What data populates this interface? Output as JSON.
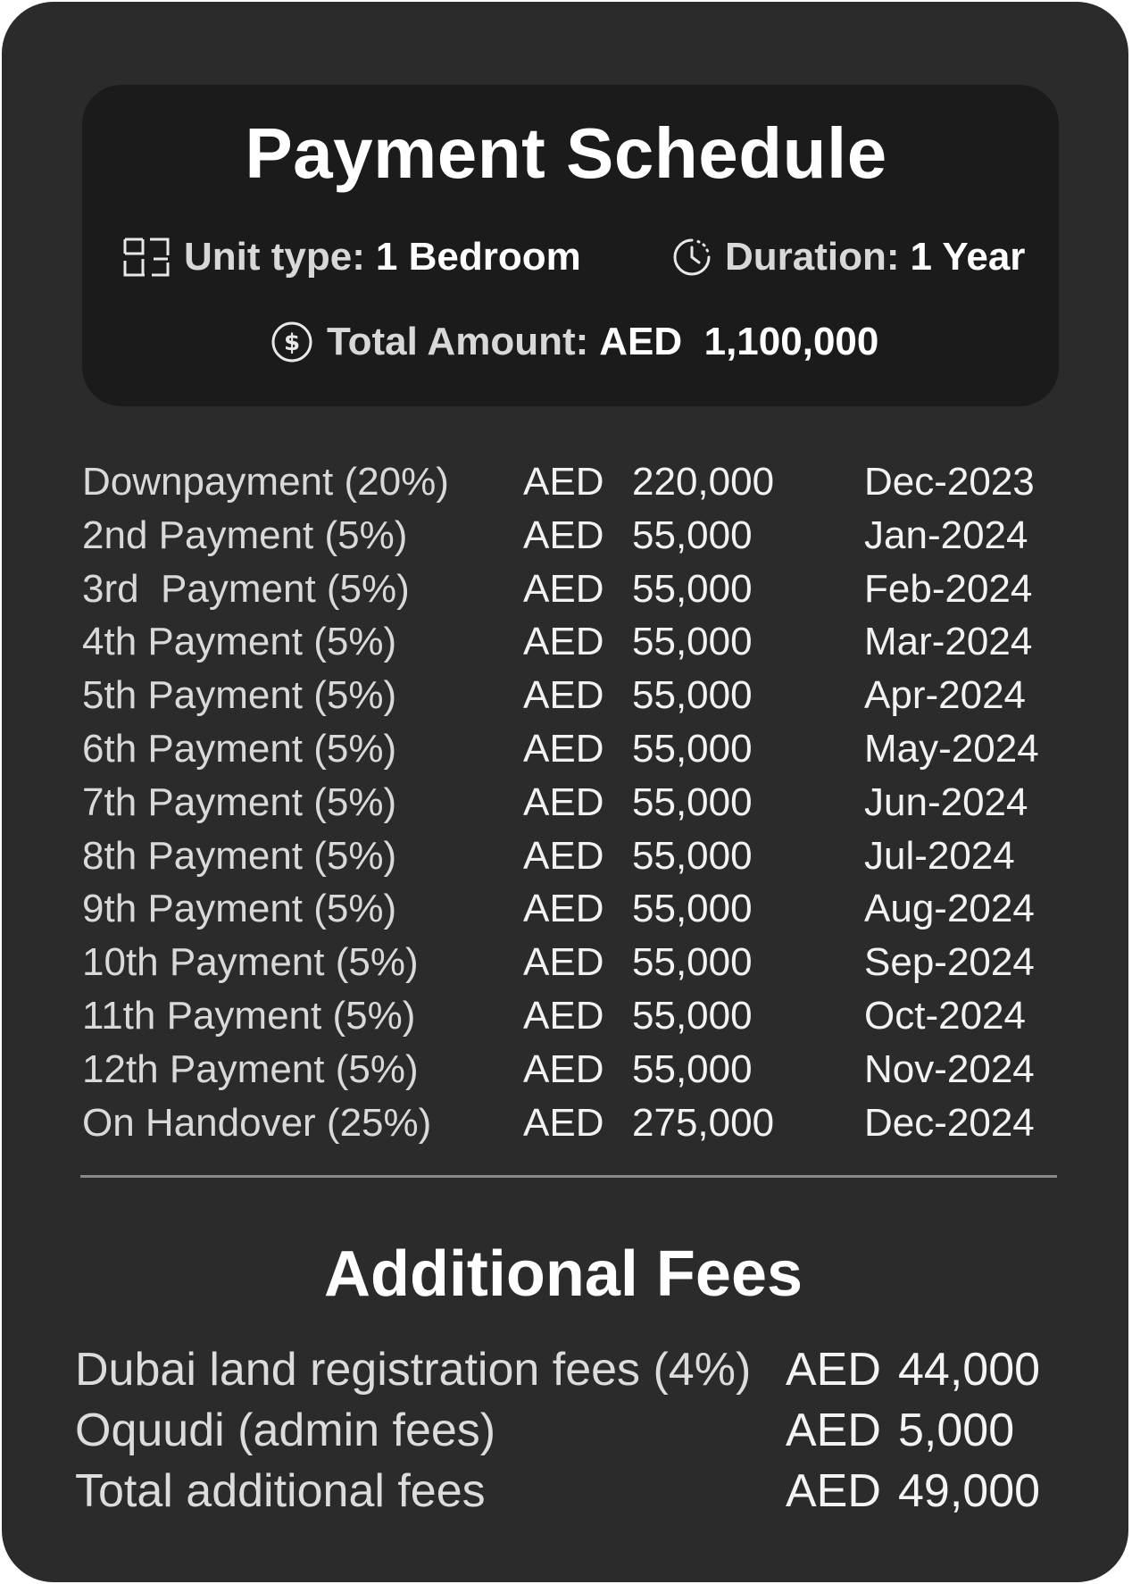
{
  "header": {
    "title": "Payment Schedule",
    "unit_type_label": "Unit type:",
    "unit_type_value": "1 Bedroom",
    "duration_label": "Duration:",
    "duration_value": "1 Year",
    "total_label": "Total Amount:",
    "total_value": "AED  1,100,000",
    "icons": [
      "floor-plan-icon",
      "clock-icon",
      "dollar-coin-icon"
    ]
  },
  "schedule": [
    {
      "label": "Downpayment (20%)",
      "currency": "AED",
      "amount": "220,000",
      "date": "Dec-2023"
    },
    {
      "label": "2nd Payment (5%)",
      "currency": "AED",
      "amount": "55,000",
      "date": "Jan-2024"
    },
    {
      "label": "3rd  Payment (5%)",
      "currency": "AED",
      "amount": "55,000",
      "date": "Feb-2024"
    },
    {
      "label": "4th Payment (5%)",
      "currency": "AED",
      "amount": "55,000",
      "date": "Mar-2024"
    },
    {
      "label": "5th Payment (5%)",
      "currency": "AED",
      "amount": "55,000",
      "date": "Apr-2024"
    },
    {
      "label": "6th Payment (5%)",
      "currency": "AED",
      "amount": "55,000",
      "date": "May-2024"
    },
    {
      "label": "7th Payment (5%)",
      "currency": "AED",
      "amount": "55,000",
      "date": "Jun-2024"
    },
    {
      "label": "8th Payment (5%)",
      "currency": "AED",
      "amount": "55,000",
      "date": "Jul-2024"
    },
    {
      "label": "9th Payment (5%)",
      "currency": "AED",
      "amount": "55,000",
      "date": "Aug-2024"
    },
    {
      "label": "10th Payment (5%)",
      "currency": "AED",
      "amount": "55,000",
      "date": "Sep-2024"
    },
    {
      "label": "11th Payment (5%)",
      "currency": "AED",
      "amount": "55,000",
      "date": "Oct-2024"
    },
    {
      "label": "12th Payment (5%)",
      "currency": "AED",
      "amount": "55,000",
      "date": "Nov-2024"
    },
    {
      "label": "On Handover (25%)",
      "currency": "AED",
      "amount": "275,000",
      "date": "Dec-2024"
    }
  ],
  "additional": {
    "title": "Additional Fees",
    "items": [
      {
        "label": "Dubai land registration fees (4%)",
        "currency": "AED",
        "amount": "44,000"
      },
      {
        "label": "Oquudi (admin fees)",
        "currency": "AED",
        "amount": "5,000"
      },
      {
        "label": "Total additional fees",
        "currency": "AED",
        "amount": "49,000"
      }
    ]
  },
  "colors": {
    "card_background": "#2b2b2b",
    "header_background": "#1b1b1b",
    "text_primary": "#ffffff",
    "text_secondary": "#d9d9d9",
    "divider": "#8a8a8a"
  }
}
